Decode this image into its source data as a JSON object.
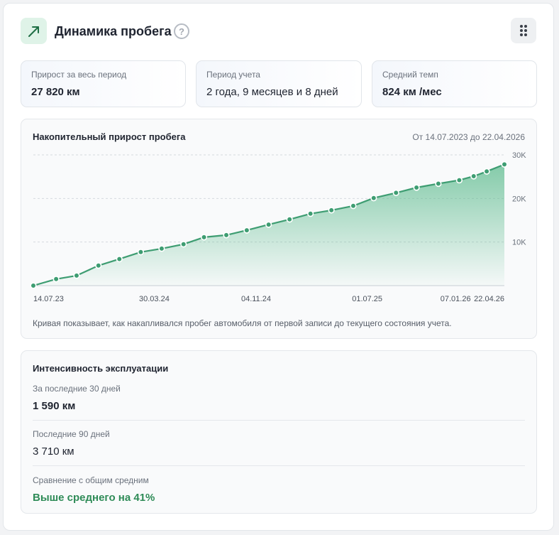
{
  "header": {
    "title": "Динамика пробега",
    "help_glyph": "?",
    "icons": {
      "trend": "trend-up-arrow-icon",
      "help": "question-circle-icon",
      "menu": "drag-dots-icon"
    }
  },
  "stats": [
    {
      "label": "Прирост за весь период",
      "value": "27 820 км"
    },
    {
      "label": "Период учета",
      "value": "2 года, 9 месяцев и 8 дней"
    },
    {
      "label": "Средний темп",
      "value": "824 км /мес"
    }
  ],
  "chart_panel": {
    "title": "Накопительный прирост пробега",
    "range": "От 14.07.2023 до 22.04.2026",
    "caption": "Кривая показывает, как накапливался пробег автомобиля от первой записи до текущего состояния учета."
  },
  "chart_data": {
    "type": "area",
    "title": "Накопительный прирост пробега",
    "x": [
      "2023-07-14",
      "2023-09-01",
      "2023-10-15",
      "2023-12-01",
      "2024-01-15",
      "2024-03-01",
      "2024-04-15",
      "2024-06-01",
      "2024-07-15",
      "2024-09-01",
      "2024-10-15",
      "2024-12-01",
      "2025-01-15",
      "2025-03-01",
      "2025-04-15",
      "2025-06-01",
      "2025-07-15",
      "2025-09-01",
      "2025-10-15",
      "2025-12-01",
      "2026-01-15",
      "2026-02-15",
      "2026-03-15",
      "2026-04-22"
    ],
    "values": [
      0,
      1500,
      2300,
      4600,
      6100,
      7700,
      8500,
      9500,
      11100,
      11600,
      12700,
      14000,
      15200,
      16500,
      17300,
      18300,
      20100,
      21300,
      22500,
      23400,
      24200,
      25100,
      26200,
      27820
    ],
    "x_ticks": [
      {
        "date": "2023-07-14",
        "label": "14.07.23"
      },
      {
        "date": "2024-03-30",
        "label": "30.03.24"
      },
      {
        "date": "2024-11-04",
        "label": "04.11.24"
      },
      {
        "date": "2025-07-01",
        "label": "01.07.25"
      },
      {
        "date": "2026-01-07",
        "label": "07.01.26"
      },
      {
        "date": "2026-04-22",
        "label": "22.04.26"
      }
    ],
    "y_ticks": [
      {
        "value": 10000,
        "label": "10K"
      },
      {
        "value": 20000,
        "label": "20K"
      },
      {
        "value": 30000,
        "label": "30K"
      }
    ],
    "ylim": [
      0,
      30000
    ],
    "grid": true,
    "colors": {
      "line": "#3e9d72",
      "area": "#5dbb8e",
      "marker_fill": "#3e9d72",
      "marker_stroke": "#ffffff"
    }
  },
  "intensity": {
    "title": "Интенсивность эксплуатации",
    "rows": [
      {
        "label": "За последние 30 дней",
        "value": "1 590 км"
      },
      {
        "label": "Последние 90 дней",
        "value": "3 710 км"
      },
      {
        "label": "Сравнение с общим средним",
        "value": "Выше среднего на 41%"
      }
    ]
  },
  "colors": {
    "accent_green": "#2e8b57",
    "badge_bg": "#dff3e8"
  }
}
